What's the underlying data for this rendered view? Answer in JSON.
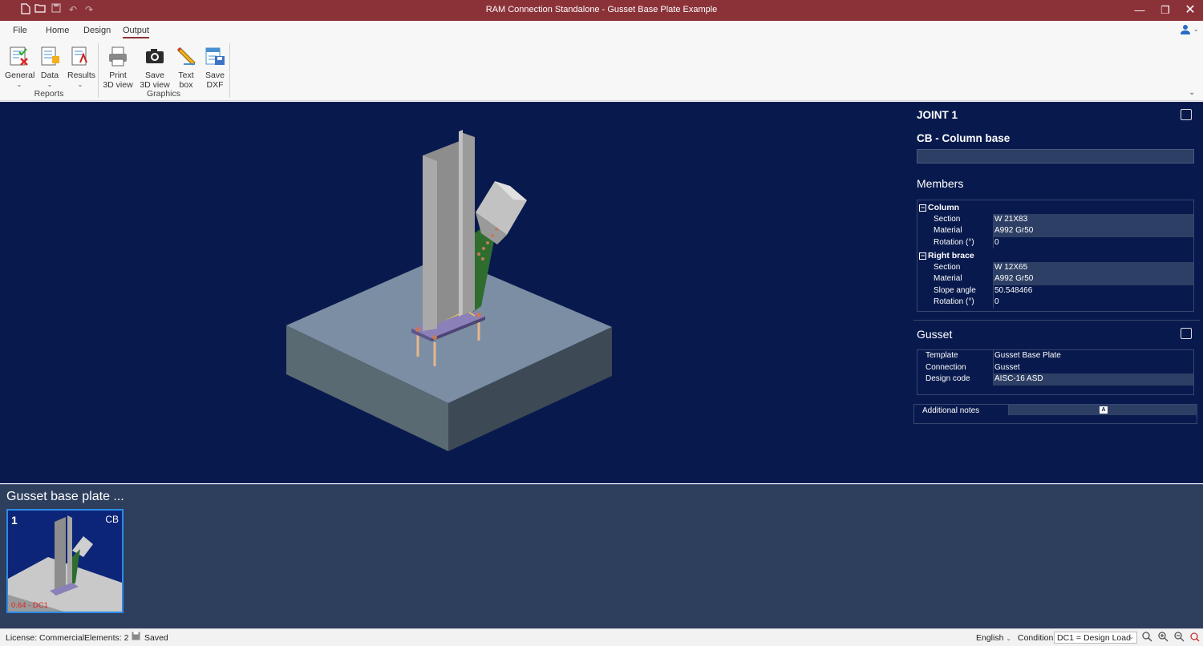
{
  "window": {
    "title": "RAM Connection Standalone - Gusset Base Plate Example",
    "minimize_icon": "minimize-icon",
    "maximize_icon": "restore-icon",
    "close_icon": "close-icon"
  },
  "menu": {
    "tabs": [
      {
        "label": "File"
      },
      {
        "label": "Home"
      },
      {
        "label": "Design"
      },
      {
        "label": "Output"
      }
    ],
    "active": "Output"
  },
  "ribbon": {
    "reports": {
      "group_label": "Reports",
      "buttons": [
        {
          "label": "General"
        },
        {
          "label": "Data"
        },
        {
          "label": "Results"
        }
      ]
    },
    "graphics": {
      "group_label": "Graphics",
      "buttons": [
        {
          "label1": "Print",
          "label2": "3D view"
        },
        {
          "label1": "Save",
          "label2": "3D view"
        },
        {
          "label1": "Text",
          "label2": "box"
        },
        {
          "label1": "Save",
          "label2": "DXF"
        }
      ]
    }
  },
  "joint": {
    "title": "JOINT 1",
    "subtitle": "CB - Column base"
  },
  "members": {
    "heading": "Members",
    "column": {
      "label": "Column",
      "rows": [
        {
          "key": "Section",
          "value": "W 21X83"
        },
        {
          "key": "Material",
          "value": "A992 Gr50"
        },
        {
          "key": "Rotation (°)",
          "value": "0"
        }
      ]
    },
    "right_brace": {
      "label": "Right brace",
      "rows": [
        {
          "key": "Section",
          "value": "W 12X65"
        },
        {
          "key": "Material",
          "value": "A992 Gr50"
        },
        {
          "key": "Slope angle",
          "value": "50.548466"
        },
        {
          "key": "Rotation (°)",
          "value": "0"
        }
      ]
    }
  },
  "gusset": {
    "heading": "Gusset",
    "rows": [
      {
        "key": "Template",
        "value": "Gusset Base Plate"
      },
      {
        "key": "Connection",
        "value": "Gusset"
      },
      {
        "key": "Design code",
        "value": "AISC-16 ASD"
      }
    ]
  },
  "notes": {
    "label": "Additional notes"
  },
  "gallery": {
    "title": "Gusset base plate ...",
    "thumb": {
      "index": "1",
      "tag": "CB",
      "ratio": "0.64 - DC1"
    }
  },
  "status": {
    "license": "License: Commercial",
    "elements": "Elements: 2",
    "saved": "Saved",
    "language": "English",
    "condition_label": "Condition:",
    "condition_value": "DC1 = Design Load"
  },
  "colors": {
    "titlebar": "#8b3239",
    "viewport": "#081a4d",
    "gallery": "#2e3e5d",
    "selection": "#2e8ae6"
  }
}
